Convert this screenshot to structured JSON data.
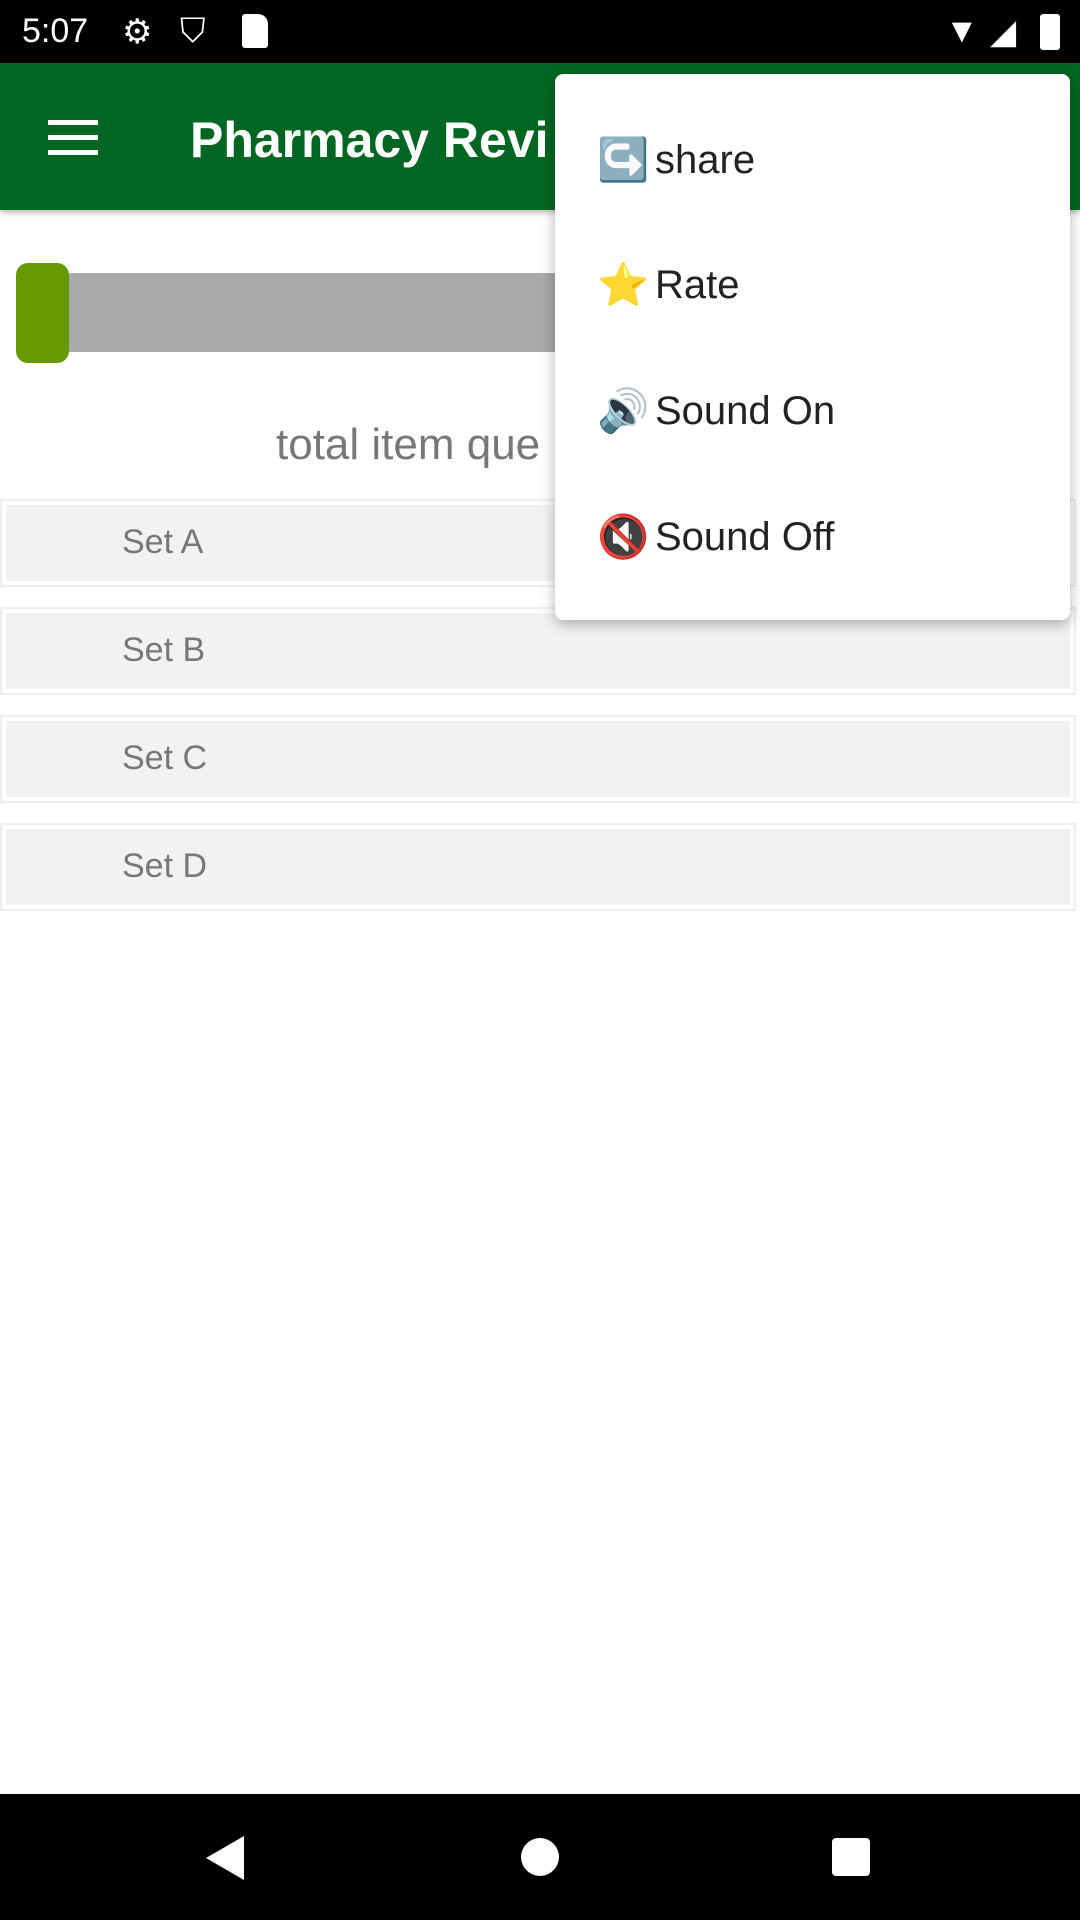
{
  "status_bar": {
    "time": "5:07",
    "icons": [
      "gear-icon",
      "shield-play-icon",
      "sd-card-icon",
      "wifi-icon",
      "signal-icon",
      "battery-icon"
    ]
  },
  "app_bar": {
    "title": "Pharmacy Revi",
    "menu_icon": "hamburger-icon",
    "color": "#006622"
  },
  "progress": {
    "value_percent": 0,
    "thumb_color": "#669900",
    "track_color": "#aaaaaa"
  },
  "total_label": "total item que",
  "sets": [
    {
      "label": "Set A"
    },
    {
      "label": "Set B"
    },
    {
      "label": "Set C"
    },
    {
      "label": "Set D"
    }
  ],
  "overflow_menu": {
    "items": [
      {
        "icon": "↪️",
        "icon_name": "share-icon",
        "label": "share"
      },
      {
        "icon": "⭐",
        "icon_name": "star-icon",
        "label": "Rate"
      },
      {
        "icon": "🔊",
        "icon_name": "speaker-on-icon",
        "label": "Sound On"
      },
      {
        "icon": "🔇",
        "icon_name": "speaker-muted-icon",
        "label": "Sound Off"
      }
    ]
  },
  "nav_bar": {
    "icons": [
      "back-icon",
      "home-icon",
      "recents-icon"
    ]
  }
}
